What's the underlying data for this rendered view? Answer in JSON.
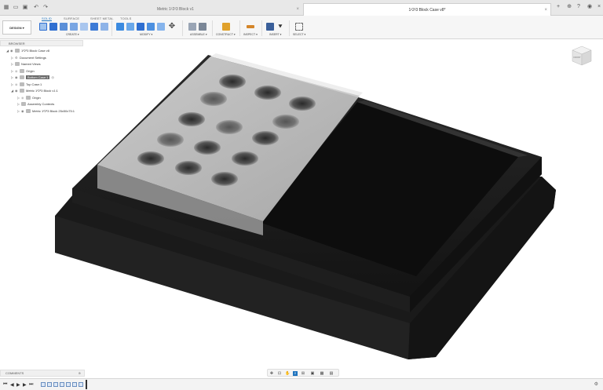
{
  "window": {
    "tabs": [
      {
        "label": "Metric 1²2²3 Block v1",
        "active": false
      },
      {
        "label": "1²2²3 Block Case v8*",
        "active": true
      }
    ]
  },
  "ribbon": {
    "tabs": [
      "SOLID",
      "SURFACE",
      "SHEET METAL",
      "TOOLS"
    ],
    "active_tab": "SOLID",
    "workspace_label": "DESIGN ▾",
    "groups": [
      "CREATE ▾",
      "MODIFY ▾",
      "ASSEMBLE ▾",
      "CONSTRUCT ▾",
      "INSPECT ▾",
      "INSERT ▾",
      "SELECT ▾"
    ],
    "colors": {
      "accent": "#1e73be",
      "create": "#2f6fd1",
      "modify": "#3c8be0",
      "construct": "#e0a12b",
      "inspect": "#d4862a",
      "insert": "#3a5f9a"
    }
  },
  "browser": {
    "title": "BROWSER",
    "items": [
      {
        "label": "1²2²3 Block Case v8",
        "caret": "◢"
      },
      {
        "label": "Document Settings",
        "caret": "▷"
      },
      {
        "label": "Named Views",
        "caret": "▷"
      },
      {
        "label": "Origin",
        "caret": "▷"
      },
      {
        "label": "Bottom Case:1",
        "caret": "▷",
        "selected": true
      },
      {
        "label": "Top Case:1",
        "caret": "▷"
      },
      {
        "label": "Metric 1²2²3 Block v1:1",
        "caret": "◢"
      },
      {
        "label": "Origin",
        "caret": "▷"
      },
      {
        "label": "Assembly Contexts",
        "caret": "▷"
      },
      {
        "label": "Metric 1²2²3 Block 25x50x75:1",
        "caret": "▷"
      }
    ]
  },
  "viewcube": {
    "face_label": "FRONT"
  },
  "comments": {
    "title": "COMMENTS"
  },
  "timeline": {
    "controls": [
      "⏮",
      "◀",
      "▶",
      "▶",
      "⏭"
    ]
  }
}
